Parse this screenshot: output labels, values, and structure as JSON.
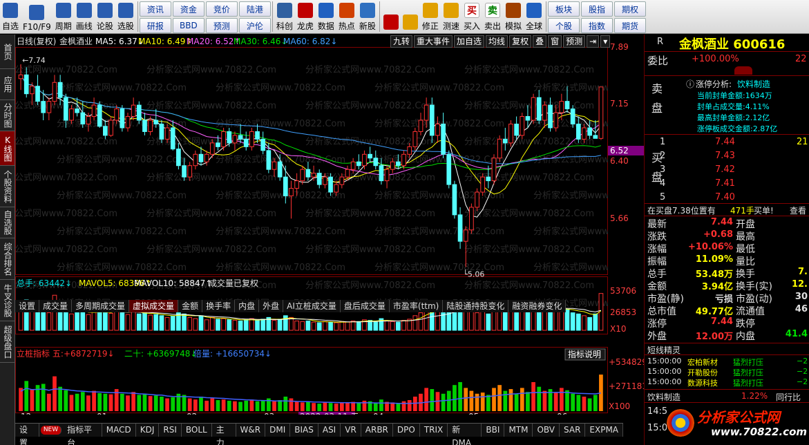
{
  "toolbar": {
    "buttons": [
      {
        "label": "自选",
        "icon": "star-icon",
        "color": "#2a5db0"
      },
      {
        "label": "F10/F9",
        "icon": "f10-icon",
        "color": "#2a5db0"
      },
      {
        "label": "周期",
        "icon": "clock-icon",
        "color": "#2a5db0"
      },
      {
        "label": "画线",
        "icon": "pen-icon",
        "color": "#2a5db0"
      },
      {
        "label": "论股",
        "icon": "chat-icon",
        "color": "#2a5db0"
      },
      {
        "label": "选股",
        "icon": "chart-select-icon",
        "color": "#2a5db0"
      }
    ],
    "grid1": [
      "资讯",
      "资金",
      "竞价",
      "陆港",
      "研报",
      "BBD",
      "预测",
      "沪伦"
    ],
    "buttons2": [
      {
        "label": "科创",
        "icon": "kechuang-icon",
        "color": "#3060a0"
      },
      {
        "label": "龙虎",
        "icon": "dragon-tiger-icon",
        "color": "#c00000"
      },
      {
        "label": "数据",
        "icon": "pe-icon",
        "color": "#2060c0"
      },
      {
        "label": "热点",
        "icon": "hot-icon",
        "color": "#d04000"
      },
      {
        "label": "新股",
        "icon": "ipo-icon",
        "color": "#3070c0"
      }
    ],
    "buttons3": [
      {
        "label": "",
        "icon": "color-blocks-icon",
        "color": "#c00000"
      },
      {
        "label": "",
        "icon": "back-arrow-icon",
        "color": "#e0a000"
      },
      {
        "label": "修正",
        "icon": "up-down-icon",
        "color": "#e0a000"
      },
      {
        "label": "测速",
        "icon": "speed-icon",
        "color": "#e0a000"
      },
      {
        "label": "买入",
        "icon": "buy-icon",
        "color": "#c00000"
      },
      {
        "label": "卖出",
        "icon": "sell-icon",
        "color": "#008000"
      },
      {
        "label": "模拟",
        "icon": "hammer-icon",
        "color": "#a04000"
      },
      {
        "label": "全球",
        "icon": "globe-icon",
        "color": "#2060c0"
      }
    ],
    "grid2": [
      "板块",
      "股指",
      "期权",
      "个股",
      "指数",
      "期货"
    ],
    "buy_glyph": "买",
    "sell_glyph": "卖"
  },
  "sidetabs": [
    "首页",
    "应用",
    "分时图",
    "K线图",
    "个股资料",
    "自选股",
    "综合排名",
    "牛叉诊股",
    "超级盘口"
  ],
  "chart_header": {
    "period": "日线(复权)",
    "name": "金枫酒业",
    "ma5": "MA5: 6.37↓",
    "ma10": "MA10: 6.49↑",
    "ma20": "MA20: 6.52↑",
    "ma30": "MA30: 6.46↓",
    "ma60": "MA60: 6.82↓"
  },
  "chart_buttons": [
    "九转",
    "重大事件",
    "加自选",
    "均线",
    "复权",
    "叠",
    "窗",
    "预测",
    "⇥",
    "▾"
  ],
  "price_axis": [
    "7.89",
    "7.15",
    "6.52",
    "6.40",
    "5.66"
  ],
  "annot": {
    "high": "7.74",
    "low": "5.06"
  },
  "vol_header": {
    "total": "总手: 63442↓",
    "mavol5": "MAVOL5: 68396↑",
    "mavol10": "MAVOL10: 58847↑",
    "note": "成交量已复权"
  },
  "vol_axis": [
    "53706",
    "26853",
    "X10"
  ],
  "vol_tabs": [
    "设置",
    "成交量",
    "多周期成交量",
    "虚拟成交量",
    "金额",
    "换手率",
    "内盘",
    "外盘",
    "AI立桩成交量",
    "盘后成交量",
    "市盈率(ttm)",
    "陆股通持股变化",
    "融资融券变化"
  ],
  "ind_header": {
    "name": "立桩指标 五:",
    "v1": "+6872719↓",
    "v2": "二十: +6369748↓",
    "v3": "倍量: +16650734↓",
    "help": "指标说明"
  },
  "ind_axis": [
    "+534829",
    "+271181",
    "X100"
  ],
  "date_axis": [
    "12",
    "01",
    "02",
    "03",
    "2022-03-11,五",
    "04",
    "05",
    "06"
  ],
  "bottom_tabs": [
    "设置",
    "NEW",
    "指标平台",
    "MACD",
    "KDJ",
    "RSI",
    "BOLL",
    "主力",
    "W&R",
    "DMI",
    "BIAS",
    "ASI",
    "VR",
    "ARBR",
    "DPO",
    "TRIX",
    "新DMA",
    "BBI",
    "MTM",
    "OBV",
    "SAR",
    "EXPMA"
  ],
  "watermark": "分析家公式网www.70822.Com",
  "right": {
    "r_label": "R",
    "title": "金枫酒业 600616",
    "weibi_label": "委比",
    "weibi": "+100.00%",
    "weibi_extra": "22",
    "zt_title": "涨停分析:",
    "zt_sector": "饮料制造",
    "zt_lines": [
      "当前封单金额:1634万",
      "封单占成交量:4.11%",
      "最高封单金额:2.12亿",
      "涨停板成交金额:2.87亿"
    ],
    "sell_label": "卖盘",
    "buy_label": "买盘",
    "buy_levels": [
      {
        "n": "1",
        "p": "7.44",
        "v": "21"
      },
      {
        "n": "2",
        "p": "7.43",
        "v": ""
      },
      {
        "n": "3",
        "p": "7.42",
        "v": ""
      },
      {
        "n": "4",
        "p": "7.41",
        "v": ""
      },
      {
        "n": "5",
        "p": "7.40",
        "v": ""
      }
    ],
    "zaimai": "在买盘7.38位置有",
    "zaimai_v": "471手",
    "zaimai_tag": "买单!",
    "zaimai_link": "查看",
    "quotes": [
      [
        "最新",
        "7.44",
        "red",
        "开盘",
        "",
        ""
      ],
      [
        "涨跌",
        "+0.68",
        "red",
        "最高",
        "",
        ""
      ],
      [
        "涨幅",
        "+10.06%",
        "red",
        "最低",
        "",
        ""
      ],
      [
        "振幅",
        "11.09%",
        "yellow",
        "量比",
        "",
        ""
      ],
      [
        "总手",
        "53.48万",
        "yellow",
        "换手",
        "7.",
        "yellow"
      ],
      [
        "金额",
        "3.94亿",
        "yellow",
        "换手(实)",
        "12.",
        "yellow"
      ],
      [
        "市盈(静)",
        "亏损",
        "white",
        "市盈(动)",
        "30",
        "white"
      ],
      [
        "总市值",
        "49.77亿",
        "yellow",
        "流通值",
        "46",
        "white"
      ],
      [
        "涨停",
        "7.44",
        "red",
        "跌停",
        "",
        ""
      ],
      [
        "外盘",
        "12.00万",
        "red",
        "内盘",
        "41.4",
        "green"
      ]
    ],
    "short_title": "短线精灵",
    "short_rows": [
      [
        "15:00:00",
        "宏柏新材",
        "猛烈打压",
        "−2"
      ],
      [
        "15:00:00",
        "开勒股份",
        "猛烈打压",
        "−2"
      ],
      [
        "15:00:00",
        "数源科技",
        "猛烈打压",
        "−2"
      ]
    ],
    "bottom_sector": "饮料制造",
    "bottom_pct": "1.22%",
    "bottom_link": "同行比",
    "times": [
      "14:5",
      "15:0"
    ],
    "logo_text": "分析家公式网",
    "logo_url": "www.70822.com"
  },
  "chart_data": {
    "type": "candlestick",
    "candles": [
      [
        7.55,
        7.74,
        7.4,
        7.6
      ],
      [
        7.6,
        7.7,
        7.3,
        7.35
      ],
      [
        7.35,
        7.5,
        7.2,
        7.45
      ],
      [
        7.45,
        7.6,
        7.2,
        7.25
      ],
      [
        7.25,
        7.4,
        7.0,
        7.1
      ],
      [
        7.1,
        7.3,
        7.0,
        7.25
      ],
      [
        7.25,
        7.6,
        7.2,
        7.5
      ],
      [
        7.5,
        7.6,
        7.2,
        7.3
      ],
      [
        7.3,
        7.35,
        6.9,
        7.0
      ],
      [
        7.0,
        7.2,
        6.95,
        7.15
      ],
      [
        7.15,
        7.3,
        7.05,
        7.1
      ],
      [
        7.1,
        7.25,
        6.9,
        6.95
      ],
      [
        6.95,
        7.1,
        6.85,
        7.05
      ],
      [
        7.05,
        7.3,
        7.0,
        7.2
      ],
      [
        7.2,
        7.25,
        6.9,
        6.92
      ],
      [
        6.92,
        7.0,
        6.75,
        6.8
      ],
      [
        6.8,
        7.05,
        6.78,
        7.0
      ],
      [
        7.0,
        7.2,
        6.95,
        7.15
      ],
      [
        7.15,
        7.2,
        6.85,
        6.9
      ],
      [
        6.9,
        7.1,
        6.85,
        7.05
      ],
      [
        7.05,
        7.3,
        7.0,
        7.2
      ],
      [
        7.2,
        7.25,
        6.95,
        7.0
      ],
      [
        7.0,
        7.1,
        6.8,
        6.85
      ],
      [
        6.85,
        7.05,
        6.8,
        7.0
      ],
      [
        7.0,
        7.15,
        6.9,
        6.95
      ],
      [
        6.95,
        7.0,
        6.7,
        6.75
      ],
      [
        6.75,
        6.95,
        6.7,
        6.9
      ],
      [
        6.9,
        7.0,
        6.6,
        6.62
      ],
      [
        6.62,
        6.7,
        6.35,
        6.4
      ],
      [
        6.4,
        6.5,
        6.2,
        6.25
      ],
      [
        6.25,
        6.45,
        6.2,
        6.4
      ],
      [
        6.4,
        6.6,
        6.35,
        6.55
      ],
      [
        6.55,
        6.65,
        6.4,
        6.45
      ],
      [
        6.45,
        6.6,
        6.4,
        6.55
      ],
      [
        6.55,
        6.75,
        6.5,
        6.7
      ],
      [
        6.7,
        6.8,
        6.6,
        6.65
      ],
      [
        6.65,
        6.9,
        6.6,
        6.85
      ],
      [
        6.85,
        6.9,
        6.65,
        6.7
      ],
      [
        6.7,
        6.85,
        6.6,
        6.8
      ],
      [
        6.8,
        6.95,
        6.7,
        6.75
      ],
      [
        6.75,
        6.85,
        6.6,
        6.65
      ],
      [
        6.65,
        6.9,
        6.6,
        6.85
      ],
      [
        6.85,
        6.95,
        6.7,
        6.75
      ],
      [
        6.75,
        6.85,
        6.55,
        6.6
      ],
      [
        6.6,
        6.7,
        6.3,
        6.35
      ],
      [
        6.35,
        6.5,
        6.25,
        6.45
      ],
      [
        6.45,
        6.55,
        6.2,
        6.25
      ],
      [
        6.25,
        6.4,
        5.9,
        6.0
      ],
      [
        6.0,
        6.2,
        5.7,
        6.1
      ],
      [
        6.1,
        6.3,
        6.0,
        6.2
      ],
      [
        6.2,
        6.4,
        6.15,
        6.35
      ],
      [
        6.35,
        6.45,
        6.2,
        6.25
      ],
      [
        6.25,
        6.4,
        6.2,
        6.3
      ],
      [
        6.3,
        6.35,
        6.1,
        6.15
      ],
      [
        6.15,
        6.3,
        6.1,
        6.25
      ],
      [
        6.25,
        6.3,
        6.0,
        6.05
      ],
      [
        6.05,
        6.2,
        6.0,
        6.15
      ],
      [
        6.15,
        6.3,
        6.1,
        6.25
      ],
      [
        6.25,
        6.4,
        6.2,
        6.35
      ],
      [
        6.35,
        6.5,
        6.3,
        6.45
      ],
      [
        6.45,
        6.55,
        6.35,
        6.4
      ],
      [
        6.4,
        6.6,
        6.35,
        6.55
      ],
      [
        6.55,
        6.65,
        6.45,
        6.5
      ],
      [
        6.5,
        6.6,
        6.35,
        6.4
      ],
      [
        6.4,
        6.5,
        6.15,
        6.2
      ],
      [
        6.2,
        6.4,
        6.1,
        6.35
      ],
      [
        6.35,
        6.5,
        6.3,
        6.45
      ],
      [
        6.45,
        6.55,
        6.35,
        6.4
      ],
      [
        6.4,
        6.6,
        6.35,
        6.55
      ],
      [
        6.55,
        6.7,
        6.5,
        6.65
      ],
      [
        6.65,
        6.9,
        6.6,
        6.85
      ],
      [
        6.85,
        7.1,
        6.8,
        7.0
      ],
      [
        7.0,
        7.3,
        6.9,
        7.2
      ],
      [
        7.2,
        7.3,
        6.7,
        6.8
      ],
      [
        6.8,
        7.05,
        6.7,
        6.95
      ],
      [
        6.95,
        7.1,
        6.5,
        6.55
      ],
      [
        6.55,
        6.6,
        6.1,
        6.15
      ],
      [
        6.15,
        6.2,
        5.7,
        5.75
      ],
      [
        5.75,
        5.85,
        5.3,
        5.4
      ],
      [
        5.4,
        5.6,
        5.06,
        5.55
      ],
      [
        5.55,
        5.9,
        5.5,
        5.85
      ],
      [
        5.85,
        6.1,
        5.8,
        6.05
      ],
      [
        6.05,
        6.3,
        6.0,
        6.25
      ],
      [
        6.25,
        6.4,
        6.1,
        6.2
      ],
      [
        6.2,
        6.55,
        6.15,
        6.5
      ],
      [
        6.5,
        6.8,
        6.45,
        6.75
      ],
      [
        6.75,
        6.9,
        6.6,
        6.7
      ],
      [
        6.7,
        7.0,
        6.65,
        6.95
      ],
      [
        6.95,
        7.05,
        6.75,
        6.8
      ],
      [
        6.8,
        7.1,
        6.75,
        7.05
      ],
      [
        7.05,
        7.2,
        6.9,
        7.0
      ],
      [
        7.0,
        7.35,
        6.95,
        7.3
      ],
      [
        7.3,
        7.4,
        6.95,
        7.0
      ],
      [
        7.0,
        7.25,
        6.9,
        7.2
      ],
      [
        7.2,
        7.3,
        6.85,
        6.9
      ],
      [
        6.9,
        7.2,
        6.85,
        7.1
      ],
      [
        7.1,
        7.35,
        7.0,
        7.25
      ],
      [
        7.25,
        7.45,
        7.1,
        7.15
      ],
      [
        7.15,
        7.2,
        6.9,
        6.95
      ],
      [
        6.95,
        7.05,
        6.7,
        6.75
      ],
      [
        6.75,
        6.95,
        6.7,
        6.9
      ],
      [
        6.9,
        7.0,
        6.75,
        6.8
      ],
      [
        6.8,
        7.0,
        6.76,
        6.76
      ],
      [
        6.76,
        7.44,
        6.74,
        7.44
      ]
    ],
    "ylim": [
      5.0,
      7.95
    ],
    "volumes": [
      40,
      52,
      38,
      45,
      47,
      30,
      60,
      42,
      36,
      28,
      30,
      33,
      27,
      35,
      31,
      30,
      29,
      38,
      30,
      27,
      33,
      28,
      30,
      26,
      27,
      25,
      22,
      24,
      30,
      28,
      22,
      20,
      25,
      18,
      22,
      19,
      20,
      18,
      17,
      16,
      18,
      20,
      17,
      19,
      22,
      17,
      19,
      25,
      22,
      16,
      15,
      16,
      14,
      13,
      15,
      14,
      13,
      15,
      14,
      16,
      15,
      18,
      17,
      14,
      20,
      16,
      15,
      14,
      17,
      19,
      25,
      30,
      40,
      38,
      33,
      30,
      35,
      45,
      50,
      40,
      35,
      30,
      32,
      28,
      40,
      45,
      35,
      38,
      30,
      40,
      33,
      50,
      42,
      35,
      38,
      32,
      40,
      36,
      30,
      28,
      25,
      22,
      28,
      63
    ],
    "vol_ylim": [
      0,
      65
    ],
    "ind_ylim": [
      0,
      75
    ]
  }
}
